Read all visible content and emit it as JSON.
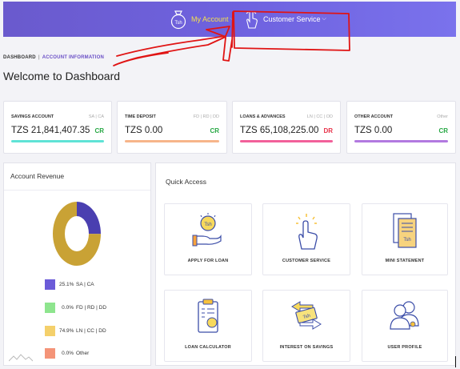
{
  "nav": {
    "my_account": "My Account",
    "customer_service": "Customer Service",
    "coin_text": "Tsh",
    "accent_color": "#6f63e0"
  },
  "breadcrumb": {
    "root": "DASHBOARD",
    "separator": "|",
    "current": "ACCOUNT INFORMATION"
  },
  "page_title": "Welcome to Dashboard",
  "accounts": [
    {
      "name": "SAVINGS ACCOUNT",
      "tags": "SA | CA",
      "amount": "TZS 21,841,407.35",
      "status": "CR",
      "status_color": "#27a844",
      "bar_color": "#5fe3d6"
    },
    {
      "name": "TIME DEPOSIT",
      "tags": "FD | RD | DD",
      "amount": "TZS 0.00",
      "status": "CR",
      "status_color": "#27a844",
      "bar_color": "#f7b58a"
    },
    {
      "name": "LOANS & ADVANCES",
      "tags": "LN | CC | OD",
      "amount": "TZS 65,108,225.00",
      "status": "DR",
      "status_color": "#e8334a",
      "bar_color": "#f2609a"
    },
    {
      "name": "OTHER ACCOUNT",
      "tags": "Other",
      "amount": "TZS 0.00",
      "status": "CR",
      "status_color": "#27a844",
      "bar_color": "#b279e0"
    }
  ],
  "revenue": {
    "title": "Account Revenue",
    "legend": [
      {
        "pct": "25.1%",
        "label": "SA | CA",
        "value": 25.1,
        "color": "#6b5bd8"
      },
      {
        "pct": "0.0%",
        "label": "FD | RD | DD",
        "value": 0.0,
        "color": "#8ee58e"
      },
      {
        "pct": "74.9%",
        "label": "LN | CC | DD",
        "value": 74.9,
        "color": "#f4d06b"
      },
      {
        "pct": "0.0%",
        "label": "Other",
        "value": 0.0,
        "color": "#f49478"
      }
    ]
  },
  "quick_access": {
    "title": "Quick Access",
    "tiles": [
      {
        "label": "APPLY FOR LOAN",
        "icon": "loan-coin-hand-icon"
      },
      {
        "label": "CUSTOMER SERVICE",
        "icon": "touch-hand-icon"
      },
      {
        "label": "MINI STATEMENT",
        "icon": "receipt-icon"
      },
      {
        "label": "LOAN CALCULATOR",
        "icon": "calculator-clipboard-icon"
      },
      {
        "label": "INTEREST ON SAVINGS",
        "icon": "money-exchange-icon"
      },
      {
        "label": "USER PROFILE",
        "icon": "users-icon"
      }
    ]
  }
}
